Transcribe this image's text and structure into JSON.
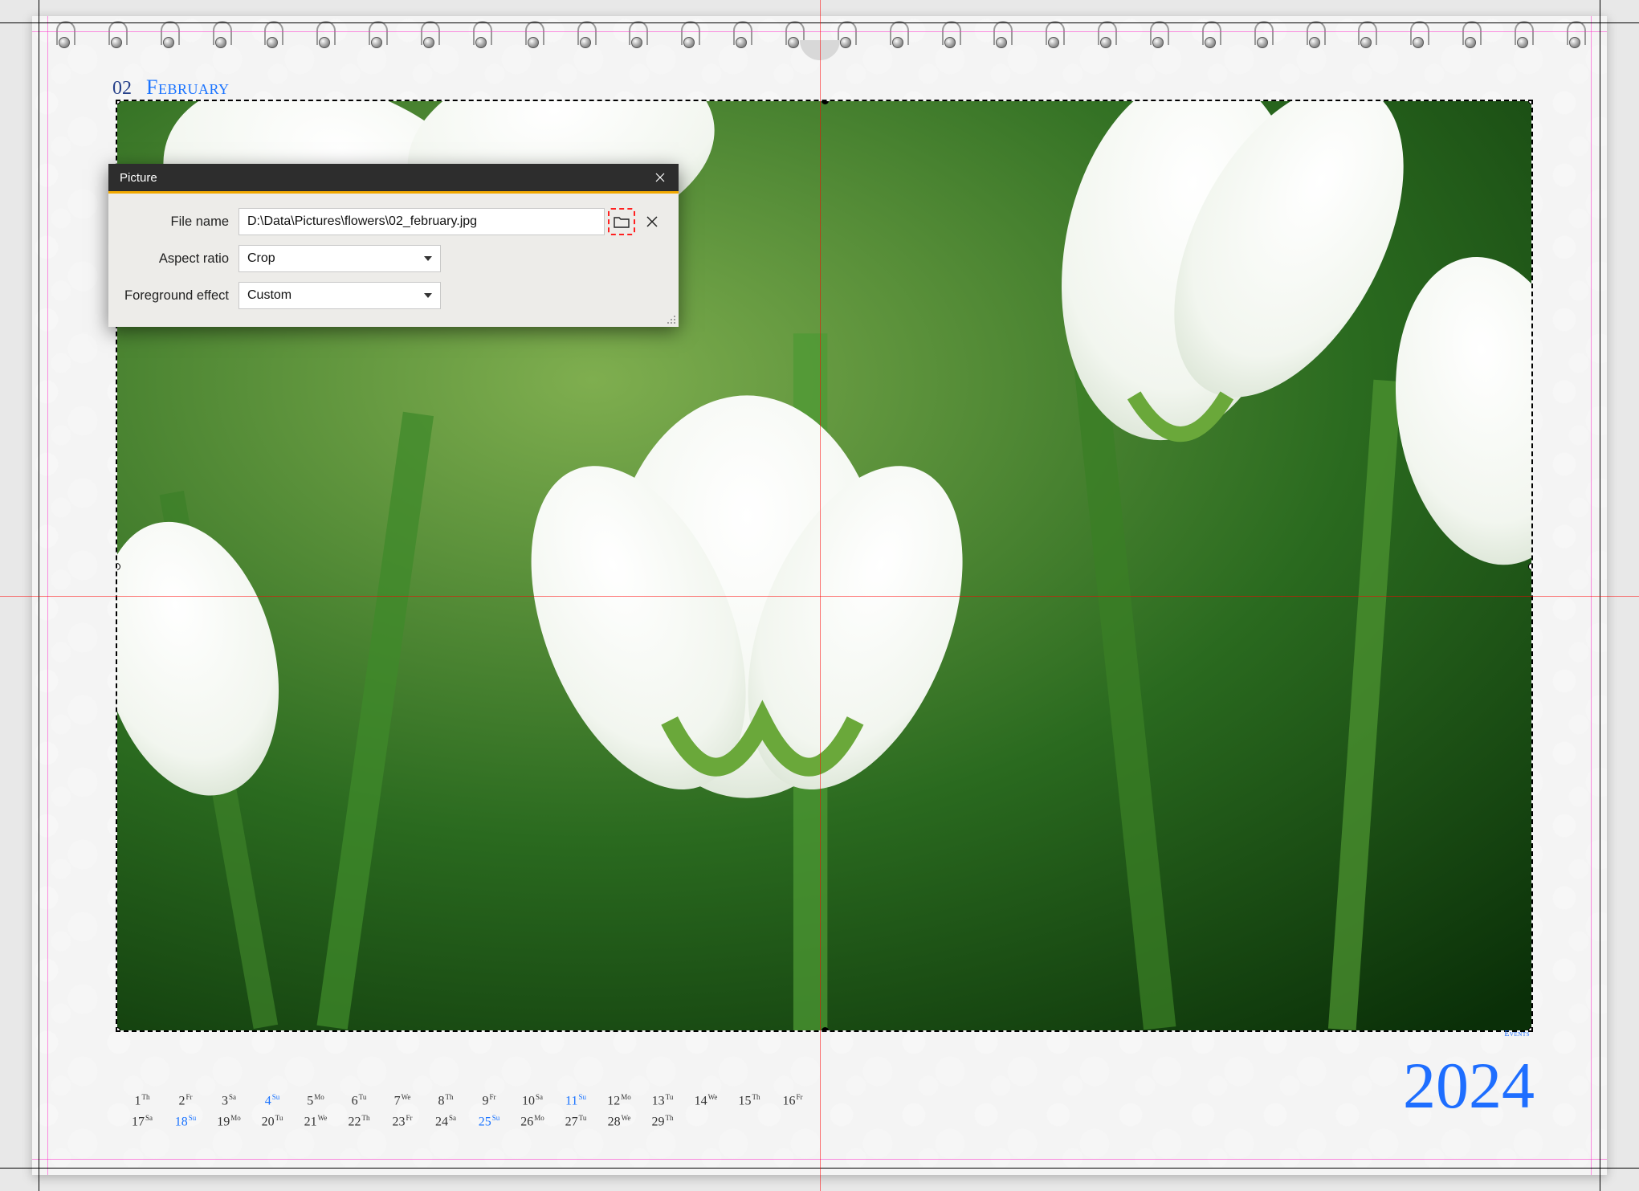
{
  "header": {
    "month_num": "02",
    "month_name": "February"
  },
  "year": "2024",
  "events_label": "Events",
  "dialog": {
    "title": "Picture",
    "file_label": "File name",
    "file_value": "D:\\Data\\Pictures\\flowers\\02_february.jpg",
    "aspect_label": "Aspect ratio",
    "aspect_value": "Crop",
    "fg_label": "Foreground effect",
    "fg_value": "Custom"
  },
  "days_row1": [
    {
      "n": "1",
      "sup": "Th",
      "sun": false
    },
    {
      "n": "2",
      "sup": "Fr",
      "sun": false
    },
    {
      "n": "3",
      "sup": "Sa",
      "sun": false
    },
    {
      "n": "4",
      "sup": "Su",
      "sun": true
    },
    {
      "n": "5",
      "sup": "Mo",
      "sun": false
    },
    {
      "n": "6",
      "sup": "Tu",
      "sun": false
    },
    {
      "n": "7",
      "sup": "We",
      "sun": false
    },
    {
      "n": "8",
      "sup": "Th",
      "sun": false
    },
    {
      "n": "9",
      "sup": "Fr",
      "sun": false
    },
    {
      "n": "10",
      "sup": "Sa",
      "sun": false
    },
    {
      "n": "11",
      "sup": "Su",
      "sun": true
    },
    {
      "n": "12",
      "sup": "Mo",
      "sun": false
    },
    {
      "n": "13",
      "sup": "Tu",
      "sun": false
    },
    {
      "n": "14",
      "sup": "We",
      "sun": false
    },
    {
      "n": "15",
      "sup": "Th",
      "sun": false
    },
    {
      "n": "16",
      "sup": "Fr",
      "sun": false
    }
  ],
  "days_row2": [
    {
      "n": "17",
      "sup": "Sa",
      "sun": false
    },
    {
      "n": "18",
      "sup": "Su",
      "sun": true
    },
    {
      "n": "19",
      "sup": "Mo",
      "sun": false
    },
    {
      "n": "20",
      "sup": "Tu",
      "sun": false
    },
    {
      "n": "21",
      "sup": "We",
      "sun": false
    },
    {
      "n": "22",
      "sup": "Th",
      "sun": false
    },
    {
      "n": "23",
      "sup": "Fr",
      "sun": false
    },
    {
      "n": "24",
      "sup": "Sa",
      "sun": false
    },
    {
      "n": "25",
      "sup": "Su",
      "sun": true
    },
    {
      "n": "26",
      "sup": "Mo",
      "sun": false
    },
    {
      "n": "27",
      "sup": "Tu",
      "sun": false
    },
    {
      "n": "28",
      "sup": "We",
      "sun": false
    },
    {
      "n": "29",
      "sup": "Th",
      "sun": false
    }
  ]
}
